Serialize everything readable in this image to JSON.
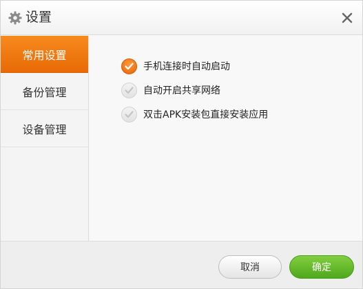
{
  "dialog": {
    "title": "设置",
    "icons": {
      "title": "gear-icon",
      "close": "close-icon"
    }
  },
  "sidebar": {
    "items": [
      {
        "label": "常用设置",
        "active": true
      },
      {
        "label": "备份管理",
        "active": false
      },
      {
        "label": "设备管理",
        "active": false
      }
    ]
  },
  "options": [
    {
      "label": "手机连接时自动启动",
      "checked": true
    },
    {
      "label": "自动开启共享网络",
      "checked": false
    },
    {
      "label": "双击APK安装包直接安装应用",
      "checked": false
    }
  ],
  "footer": {
    "cancel_label": "取消",
    "ok_label": "确定"
  },
  "colors": {
    "accent": "#f07a10",
    "confirm": "#5cb52a"
  }
}
